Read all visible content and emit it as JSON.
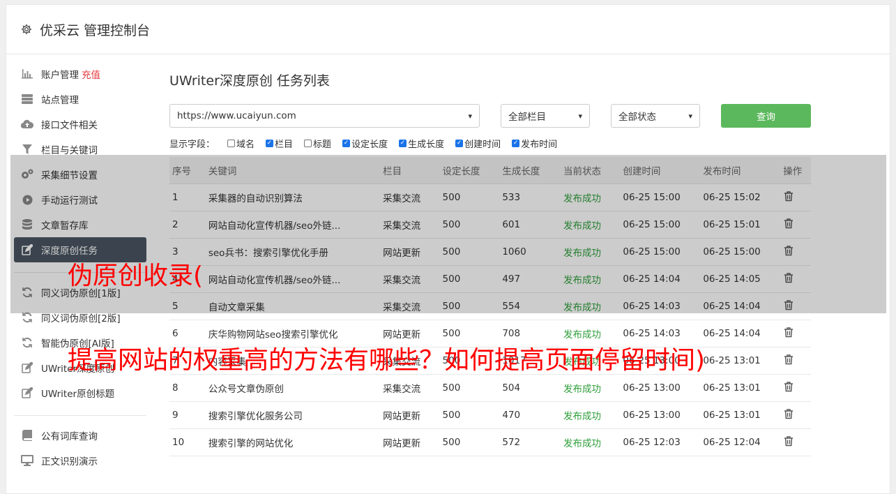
{
  "header": {
    "title": "优采云 管理控制台",
    "icon": "gear-icon"
  },
  "sidebar": {
    "group1": [
      {
        "label": "账户管理",
        "extra": "充值",
        "icon": "bar-chart-icon"
      },
      {
        "label": "站点管理",
        "icon": "server-icon"
      },
      {
        "label": "接口文件相关",
        "icon": "cloud-upload-icon"
      },
      {
        "label": "栏目与关键词",
        "icon": "filter-icon"
      },
      {
        "label": "采集细节设置",
        "icon": "cogs-icon"
      },
      {
        "label": "手动运行测试",
        "icon": "play-circle-icon"
      },
      {
        "label": "文章暂存库",
        "icon": "database-icon"
      },
      {
        "label": "深度原创任务",
        "icon": "edit-icon",
        "active": true
      }
    ],
    "group2": [
      {
        "label": "同义词伪原创[1版]",
        "icon": "refresh-icon"
      },
      {
        "label": "同义词伪原创[2版]",
        "icon": "refresh-icon"
      },
      {
        "label": "智能伪原创[AI版]",
        "icon": "refresh-icon"
      },
      {
        "label": "UWriter深度原创",
        "icon": "edit-icon"
      },
      {
        "label": "UWriter原创标题",
        "icon": "edit-icon"
      }
    ],
    "group3": [
      {
        "label": "公有词库查询",
        "icon": "book-icon"
      },
      {
        "label": "正文识别演示",
        "icon": "monitor-icon"
      }
    ]
  },
  "main": {
    "title": "UWriter深度原创 任务列表",
    "filters": {
      "site": "https://www.ucaiyun.com",
      "column": "全部栏目",
      "status": "全部状态",
      "query_label": "查询"
    },
    "fields": {
      "label": "显示字段：",
      "options": [
        {
          "label": "域名",
          "checked": false
        },
        {
          "label": "栏目",
          "checked": true
        },
        {
          "label": "标题",
          "checked": false
        },
        {
          "label": "设定长度",
          "checked": true
        },
        {
          "label": "生成长度",
          "checked": true
        },
        {
          "label": "创建时间",
          "checked": true
        },
        {
          "label": "发布时间",
          "checked": true
        }
      ]
    },
    "table": {
      "headers": [
        "序号",
        "关键词",
        "栏目",
        "设定长度",
        "生成长度",
        "当前状态",
        "创建时间",
        "发布时间",
        "操作"
      ],
      "rows": [
        [
          "1",
          "采集器的自动识别算法",
          "采集交流",
          "500",
          "533",
          "发布成功",
          "06-25 15:00",
          "06-25 15:02"
        ],
        [
          "2",
          "网站自动化宣传机器/seo外链...",
          "采集交流",
          "500",
          "601",
          "发布成功",
          "06-25 15:00",
          "06-25 15:01"
        ],
        [
          "3",
          "seo兵书：搜索引擎优化手册",
          "网站更新",
          "500",
          "1060",
          "发布成功",
          "06-25 15:00",
          "06-25 15:00"
        ],
        [
          "4",
          "网站自动化宣传机器/seo外链...",
          "采集交流",
          "500",
          "497",
          "发布成功",
          "06-25 14:04",
          "06-25 14:05"
        ],
        [
          "5",
          "自动文章采集",
          "采集交流",
          "500",
          "554",
          "发布成功",
          "06-25 14:03",
          "06-25 14:04"
        ],
        [
          "6",
          "庆华购物网站seo搜索引擎优化",
          "网站更新",
          "500",
          "708",
          "发布成功",
          "06-25 14:03",
          "06-25 14:04"
        ],
        [
          "7",
          "内容采集",
          "采集交流",
          "500",
          "1017",
          "发布成功",
          "06-25 13:00",
          "06-25 13:01"
        ],
        [
          "8",
          "公众号文章伪原创",
          "采集交流",
          "500",
          "504",
          "发布成功",
          "06-25 13:00",
          "06-25 13:01"
        ],
        [
          "9",
          "搜索引擎优化服务公司",
          "网站更新",
          "500",
          "470",
          "发布成功",
          "06-25 13:00",
          "06-25 13:01"
        ],
        [
          "10",
          "搜索引擎的网站优化",
          "网站更新",
          "500",
          "572",
          "发布成功",
          "06-25 12:03",
          "06-25 12:04"
        ]
      ]
    }
  },
  "overlay": {
    "line1": "伪原创收录(",
    "line2": "提高网站的权重高的方法有哪些？如何提高页面停留时间)"
  }
}
